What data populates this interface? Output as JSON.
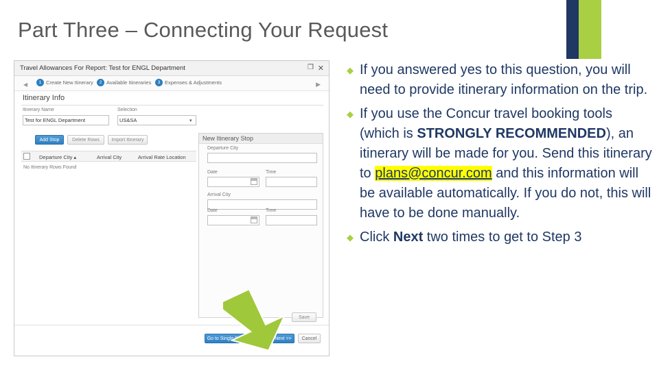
{
  "slide": {
    "title": "Part Three – Connecting Your Request"
  },
  "bullets": [
    {
      "marker": "◆",
      "html_id": "b1"
    },
    {
      "marker": "◆",
      "html_id": "b2"
    },
    {
      "marker": "◆",
      "html_id": "b3"
    }
  ],
  "bullet_text": {
    "b1": "If you answered yes to this question, you will need to provide itinerary information on the trip.",
    "b2_part1": "If you use the Concur travel booking tools (which is ",
    "b2_strong": "STRONGLY RECOMMENDED",
    "b2_part2": "), an itinerary will be made for you. Send this itinerary to ",
    "b2_link": "plans@concur.com",
    "b2_part3": " and this information will be available automatically. If you do not, this will have to be done manually.",
    "b3_part1": "Click ",
    "b3_strong": "Next",
    "b3_part2": " two times to get to Step 3"
  },
  "screenshot": {
    "window_title": "Travel Allowances For Report: Test for ENGL Department",
    "restore_icon": "❐",
    "close_icon": "✕",
    "steps": [
      {
        "num": "1",
        "label": "Create New Itinerary"
      },
      {
        "num": "2",
        "label": "Available Itineraries"
      },
      {
        "num": "3",
        "label": "Expenses & Adjustments"
      }
    ],
    "arrow_left": "◀",
    "arrow_right": "▶",
    "section_heading": "Itinerary Info",
    "fields": {
      "itinerary_name_label": "Itinerary Name",
      "itinerary_name_value": "Test for ENGL Department",
      "selection_label": "Selection",
      "selection_value": "US&SA",
      "selection_caret": "▾"
    },
    "buttons": {
      "add_stop": "Add Stop",
      "delete_rows": "Delete Rows",
      "import_itinerary": "Import Itinerary",
      "save": "Save",
      "go_single_day": "Go to Single Day Itineraries",
      "next": "Next >>",
      "cancel": "Cancel"
    },
    "table": {
      "columns": [
        "Departure City ▴",
        "Arrival City",
        "Arrival Rate Location"
      ],
      "empty_message": "No Itinerary Rows Found"
    },
    "subpanel": {
      "title": "New Itinerary Stop",
      "departure_city_label": "Departure City",
      "date_label_1": "Date",
      "time_label_1": "Time",
      "arrival_city_label": "Arrival City",
      "date_label_2": "Date",
      "time_label_2": "Time"
    }
  },
  "colors": {
    "accent_green": "#a9d043",
    "navy": "#1f3864",
    "title_gray": "#595959",
    "highlight_yellow": "#ffff00"
  }
}
